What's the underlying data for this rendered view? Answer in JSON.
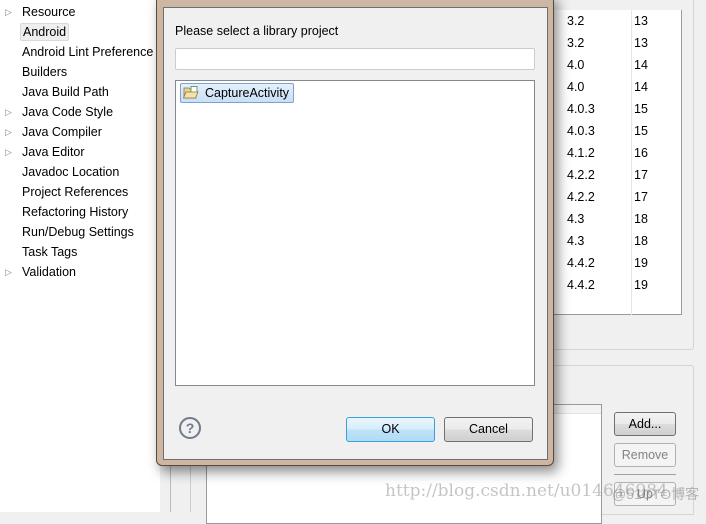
{
  "tree": {
    "items": [
      {
        "label": "Resource",
        "expandable": true
      },
      {
        "label": "Android",
        "expandable": false,
        "selected": true
      },
      {
        "label": "Android Lint Preference",
        "expandable": false
      },
      {
        "label": "Builders",
        "expandable": false
      },
      {
        "label": "Java Build Path",
        "expandable": false
      },
      {
        "label": "Java Code Style",
        "expandable": true
      },
      {
        "label": "Java Compiler",
        "expandable": true
      },
      {
        "label": "Java Editor",
        "expandable": true
      },
      {
        "label": "Javadoc Location",
        "expandable": false
      },
      {
        "label": "Project References",
        "expandable": false
      },
      {
        "label": "Refactoring History",
        "expandable": false
      },
      {
        "label": "Run/Debug Settings",
        "expandable": false
      },
      {
        "label": "Task Tags",
        "expandable": false
      },
      {
        "label": "Validation",
        "expandable": true
      }
    ]
  },
  "targets": {
    "rows": [
      [
        "3.2",
        "13"
      ],
      [
        "3.2",
        "13"
      ],
      [
        "4.0",
        "14"
      ],
      [
        "4.0",
        "14"
      ],
      [
        "4.0.3",
        "15"
      ],
      [
        "4.0.3",
        "15"
      ],
      [
        "4.1.2",
        "16"
      ],
      [
        "4.2.2",
        "17"
      ],
      [
        "4.2.2",
        "17"
      ],
      [
        "4.3",
        "18"
      ],
      [
        "4.3",
        "18"
      ],
      [
        "4.4.2",
        "19"
      ],
      [
        "4.4.2",
        "19"
      ]
    ]
  },
  "library": {
    "add": "Add...",
    "remove": "Remove",
    "up": "Up"
  },
  "dialog": {
    "prompt": "Please select a library project",
    "filter_value": "",
    "items": [
      "CaptureActivity"
    ],
    "ok": "OK",
    "cancel": "Cancel",
    "help_glyph": "?"
  },
  "watermark": {
    "url": "http://blog.csdn.net/u014646984",
    "site": "@51CTO博客"
  }
}
